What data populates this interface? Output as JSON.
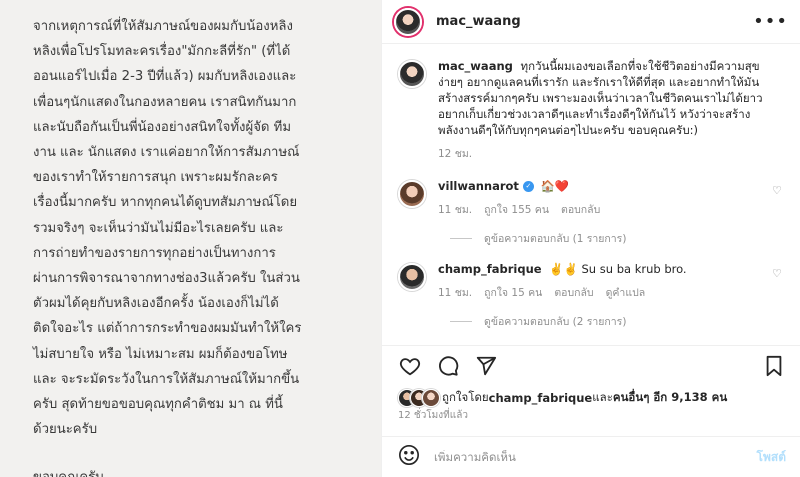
{
  "left": {
    "caption": "จากเหตุการณ์ที่ให้สัมภาษณ์ของผมกับน้องหลิง\nหลิงเพื่อโปรโมทละครเรื่อง\"มักกะลีที่รัก\" (ที่ได้\nออนแอร์ไปเมื่อ 2-3 ปีที่แล้ว) ผมกับหลิงเองและ\nเพื่อนๆนักแสดงในกองหลายคน เราสนิทกันมาก\nและนับถือกันเป็นพี่น้องอย่างสนิทใจทั้งผู้จัด ทีม\nงาน และ นักแสดง เราแค่อยากให้การสัมภาษณ์\nของเราทำให้รายการสนุก เพราะผมรักละคร\nเรื่องนี้มากครับ หากทุกคนได้ดูบทสัมภาษณ์โดย\nรวมจริงๆ จะเห็นว่ามันไม่มีอะไรเลยครับ และ\nการถ่ายทำของรายการทุกอย่างเป็นทางการ\nผ่านการพิจารณาจากทางช่อง3แล้วครับ ในส่วน\nตัวผมได้คุยกับหลิงเองอีกครั้ง น้องเองก็ไม่ได้\nติดใจอะไร แต่ถ้าการกระทำของผมมันทำให้ใคร\nไม่สบายใจ หรือ ไม่เหมาะสม ผมก็ต้องขอโทษ\nและ จะระมัดระวังในการให้สัมภาษณ์ให้มากขึ้น\nครับ สุดท้ายขอขอบคุณทุกคำติชม มา ณ ที่นี้\nด้วยนะครับ",
    "thanks": "ขอบคุณครับ"
  },
  "header": {
    "username": "mac_waang",
    "more_icon": "more-horizontal-icon"
  },
  "caption_comment": {
    "username": "mac_waang",
    "text": "ทุกวันนี้ผมเองขอเลือกที่จะใช้ชีวิตอย่างมีความสุขง่ายๆ อยากดูแลคนที่เรารัก และรักเราให้ดีที่สุด และอยากทำให้มันสร้างสรรค์มากๆครับ เพราะมองเห็นว่าเวลาในชีวิตคนเราไม่ได้ยาว อยากเก็บเกี่ยวช่วงเวลาดีๆและทำเรื่องดีๆให้กันไว้ หวังว่าจะสร้างพลังงานดีๆให้กับทุกๆคนต่อๆไปนะครับ ขอบคุณครับ:)",
    "time": "12 ชม."
  },
  "comments": [
    {
      "username": "villwannarot",
      "verified": true,
      "text": "🏠❤️",
      "time": "11 ชม.",
      "likes": "ถูกใจ 155 คน",
      "reply": "ตอบกลับ",
      "translate": "",
      "view_replies": "ดูข้อความตอบกลับ (1 รายการ)"
    },
    {
      "username": "champ_fabrique",
      "verified": false,
      "text": "✌️✌️ Su su ba krub bro.",
      "time": "11 ชม.",
      "likes": "ถูกใจ 15 คน",
      "reply": "ตอบกลับ",
      "translate": "ดูคำแปล",
      "view_replies": "ดูข้อความตอบกลับ (2 รายการ)"
    }
  ],
  "likes_line": {
    "prefix": "ถูกใจโดย ",
    "user": "champ_fabrique",
    "mid": " และ",
    "others": "คนอื่นๆ อีก 9,138 คน"
  },
  "time_ago": "12 ชั่วโมงที่แล้ว",
  "add_comment": {
    "placeholder": "เพิ่มความคิดเห็น",
    "post_label": "โพสต์"
  },
  "colors": {
    "verified": "#3897f0",
    "post_button": "#b2dffc",
    "muted": "#8e8e8e"
  }
}
